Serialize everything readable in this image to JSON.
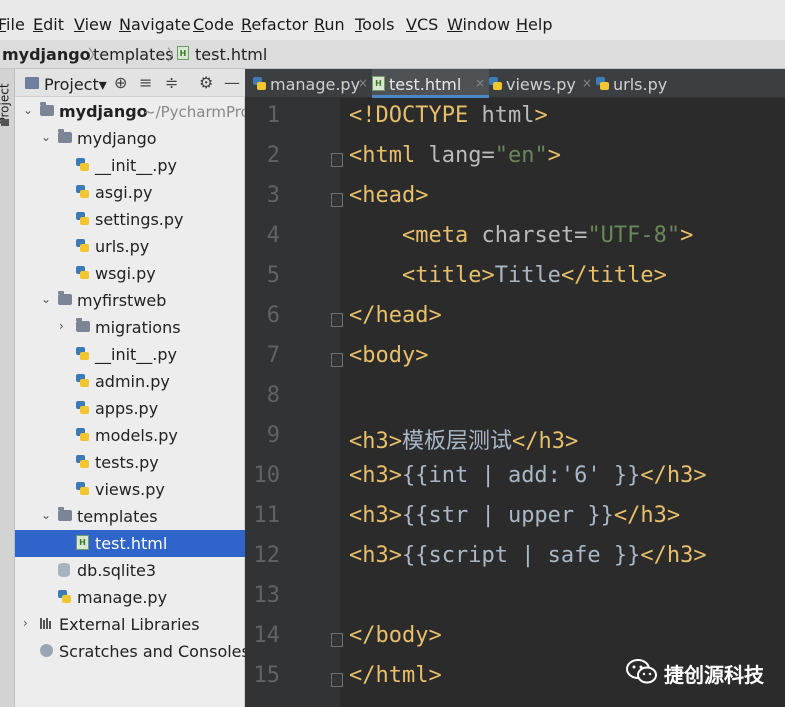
{
  "menu": [
    {
      "label": "File",
      "underline": "F",
      "rest": "ile"
    },
    {
      "label": "Edit",
      "underline": "E",
      "rest": "dit"
    },
    {
      "label": "View",
      "underline": "V",
      "rest": "iew"
    },
    {
      "label": "Navigate",
      "underline": "N",
      "rest": "avigate"
    },
    {
      "label": "Code",
      "underline": "C",
      "rest": "ode"
    },
    {
      "label": "Refactor",
      "underline": "R",
      "rest": "efactor"
    },
    {
      "label": "Run",
      "underline": "R",
      "rest": "un"
    },
    {
      "label": "Tools",
      "underline": "T",
      "rest": "ools"
    },
    {
      "label": "VCS",
      "underline": "V",
      "rest": "CS"
    },
    {
      "label": "Window",
      "underline": "W",
      "rest": "indow"
    },
    {
      "label": "Help",
      "underline": "H",
      "rest": "elp"
    }
  ],
  "breadcrumb": {
    "project": "mydjango",
    "folder": "templates",
    "file": "test.html",
    "sep": "〉"
  },
  "toolstrip": {
    "label": "Project"
  },
  "project_panel": {
    "title": "Project▾",
    "icons": {
      "locate": "⊕",
      "collapse": "≡",
      "expand": "≑",
      "settings": "⚙",
      "hide": "—"
    },
    "tree": [
      {
        "label": "mydjango",
        "sub": "~/PycharmProj",
        "bold": true,
        "icon": "folder",
        "arrow": "⌄"
      },
      {
        "label": "mydjango",
        "icon": "folder",
        "arrow": "⌄"
      },
      {
        "label": "__init__.py",
        "icon": "python-file"
      },
      {
        "label": "asgi.py",
        "icon": "python-file"
      },
      {
        "label": "settings.py",
        "icon": "python-file"
      },
      {
        "label": "urls.py",
        "icon": "python-file"
      },
      {
        "label": "wsgi.py",
        "icon": "python-file"
      },
      {
        "label": "myfirstweb",
        "icon": "folder",
        "arrow": "⌄"
      },
      {
        "label": "migrations",
        "icon": "folder",
        "arrow": "›"
      },
      {
        "label": "__init__.py",
        "icon": "python-file"
      },
      {
        "label": "admin.py",
        "icon": "python-file"
      },
      {
        "label": "apps.py",
        "icon": "python-file"
      },
      {
        "label": "models.py",
        "icon": "python-file"
      },
      {
        "label": "tests.py",
        "icon": "python-file"
      },
      {
        "label": "views.py",
        "icon": "python-file"
      },
      {
        "label": "templates",
        "icon": "folder",
        "arrow": "⌄"
      },
      {
        "label": "test.html",
        "icon": "html-file",
        "selected": true
      },
      {
        "label": "db.sqlite3",
        "icon": "database-file"
      },
      {
        "label": "manage.py",
        "icon": "python-file"
      },
      {
        "label": "External Libraries",
        "icon": "library",
        "arrow": "›"
      },
      {
        "label": "Scratches and Consoles",
        "icon": "scratches"
      }
    ]
  },
  "tabs": [
    {
      "label": "manage.py",
      "close": "×",
      "icon": "python-file"
    },
    {
      "label": "test.html",
      "close": "×",
      "icon": "html-file",
      "active": true
    },
    {
      "label": "views.py",
      "close": "×",
      "icon": "python-file"
    },
    {
      "label": "urls.py",
      "close": "",
      "icon": "python-file"
    }
  ],
  "editor": {
    "line_numbers": [
      "1",
      "2",
      "3",
      "4",
      "5",
      "6",
      "7",
      "8",
      "9",
      "10",
      "11",
      "12",
      "13",
      "14",
      "15"
    ],
    "lines": [
      [
        {
          "t": "tag",
          "v": "<!DOCTYPE "
        },
        {
          "t": "attr",
          "v": "html"
        },
        {
          "t": "tag",
          "v": ">"
        }
      ],
      [
        {
          "t": "tag",
          "v": "<html "
        },
        {
          "t": "attr",
          "v": "lang="
        },
        {
          "t": "str",
          "v": "\"en\""
        },
        {
          "t": "tag",
          "v": ">"
        }
      ],
      [
        {
          "t": "tag",
          "v": "<head>"
        }
      ],
      [
        {
          "t": "txt",
          "v": "    "
        },
        {
          "t": "tag",
          "v": "<meta "
        },
        {
          "t": "attr",
          "v": "charset="
        },
        {
          "t": "str",
          "v": "\"UTF-8\""
        },
        {
          "t": "tag",
          "v": ">"
        }
      ],
      [
        {
          "t": "txt",
          "v": "    "
        },
        {
          "t": "tag",
          "v": "<title>"
        },
        {
          "t": "txt",
          "v": "Title"
        },
        {
          "t": "tag",
          "v": "</title>"
        }
      ],
      [
        {
          "t": "tag",
          "v": "</head>"
        }
      ],
      [
        {
          "t": "tag",
          "v": "<body>"
        }
      ],
      [],
      [
        {
          "t": "tag",
          "v": "<h3>"
        },
        {
          "t": "txt",
          "v": "模板层测试"
        },
        {
          "t": "tag",
          "v": "</h3>"
        }
      ],
      [
        {
          "t": "tag",
          "v": "<h3>"
        },
        {
          "t": "txt",
          "v": "{{int | add:'6' }}"
        },
        {
          "t": "tag",
          "v": "</h3>"
        }
      ],
      [
        {
          "t": "tag",
          "v": "<h3>"
        },
        {
          "t": "txt",
          "v": "{{str | upper }}"
        },
        {
          "t": "tag",
          "v": "</h3>"
        }
      ],
      [
        {
          "t": "tag",
          "v": "<h3>"
        },
        {
          "t": "txt",
          "v": "{{script | safe }}"
        },
        {
          "t": "tag",
          "v": "</h3>"
        }
      ],
      [],
      [
        {
          "t": "tag",
          "v": "</body>"
        }
      ],
      [
        {
          "t": "tag",
          "v": "</html>"
        }
      ]
    ],
    "fold_markers_on_lines": [
      2,
      3,
      6,
      7,
      14,
      15
    ]
  },
  "watermark": {
    "text": "捷创源科技",
    "icon": "wechat-icon"
  },
  "colors": {
    "tag": "#e8bf6a",
    "attr": "#bababa",
    "string": "#6a8759",
    "text": "#a9b7c6",
    "selection": "#2f65ca",
    "editor_bg": "#2b2b2b",
    "gutter_bg": "#313335"
  }
}
